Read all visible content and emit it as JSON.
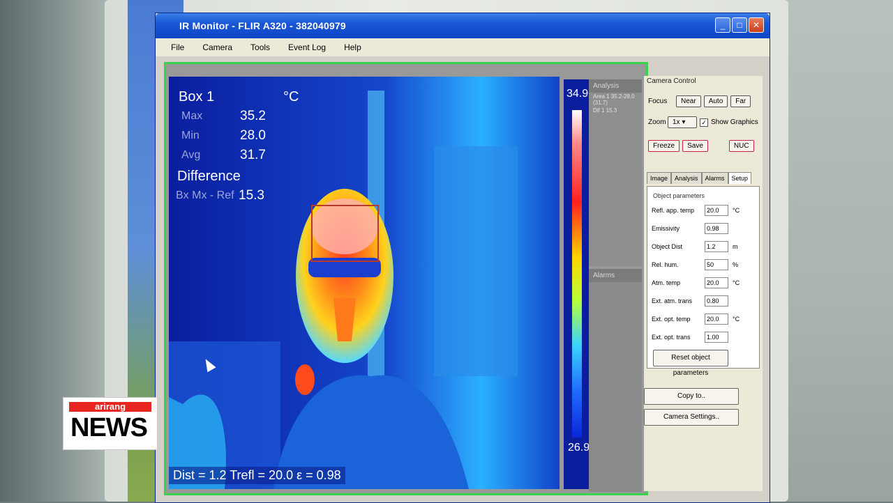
{
  "window": {
    "title": "IR Monitor - FLIR A320 - 382040979",
    "controls": [
      "_",
      "□",
      "✕"
    ]
  },
  "menu": [
    "File",
    "Camera",
    "Tools",
    "Event Log",
    "Help"
  ],
  "thermal": {
    "box_title": "Box 1",
    "unit": "°C",
    "max_label": "Max",
    "max_value": "35.2",
    "min_label": "Min",
    "min_value": "28.0",
    "avg_label": "Avg",
    "avg_value": "31.7",
    "difference_title": "Difference",
    "diff_label": "Bx Mx - Ref",
    "diff_value": "15.3",
    "footer": "Dist = 1.2  Trefl = 20.0  ε = 0.98",
    "scale_max": "34.9",
    "scale_min": "26.9"
  },
  "analysis": {
    "title": "Analysis",
    "lines": [
      "Area 1 35.2-28.0 (31.7)",
      "Dif 1 15.3"
    ],
    "alarms_title": "Alarms"
  },
  "camera_control": {
    "title": "Camera Control",
    "focus_label": "Focus",
    "focus_buttons": [
      "Near",
      "Auto",
      "Far"
    ],
    "zoom_label": "Zoom",
    "zoom_value": "1x",
    "show_graphics": "Show Graphics",
    "freeze": "Freeze",
    "save": "Save",
    "nuc": "NUC",
    "tabs": [
      "Image",
      "Analysis",
      "Alarms",
      "Setup"
    ],
    "object_parameters_title": "Object parameters",
    "params": [
      {
        "label": "Refl. app. temp",
        "value": "20.0",
        "unit": "°C"
      },
      {
        "label": "Emissivity",
        "value": "0.98",
        "unit": ""
      },
      {
        "label": "Object Dist",
        "value": "1.2",
        "unit": "m"
      },
      {
        "label": "Rel. hum.",
        "value": "50",
        "unit": "%"
      },
      {
        "label": "Atm. temp",
        "value": "20.0",
        "unit": "°C"
      },
      {
        "label": "Ext. atm. trans",
        "value": "0.80",
        "unit": ""
      },
      {
        "label": "Ext. opt. temp",
        "value": "20.0",
        "unit": "°C"
      },
      {
        "label": "Ext. opt. trans",
        "value": "1.00",
        "unit": ""
      }
    ],
    "reset_button": "Reset object parameters",
    "copy_button": "Copy to..",
    "camera_settings_button": "Camera Settings.."
  },
  "overlay": {
    "brand": "arirang",
    "word": "NEWS"
  },
  "colors": {
    "thermal_cold": "#0b1f9e",
    "thermal_hot": "#ff2020",
    "frame_green": "#39d24a",
    "news_red": "#e8261f"
  }
}
